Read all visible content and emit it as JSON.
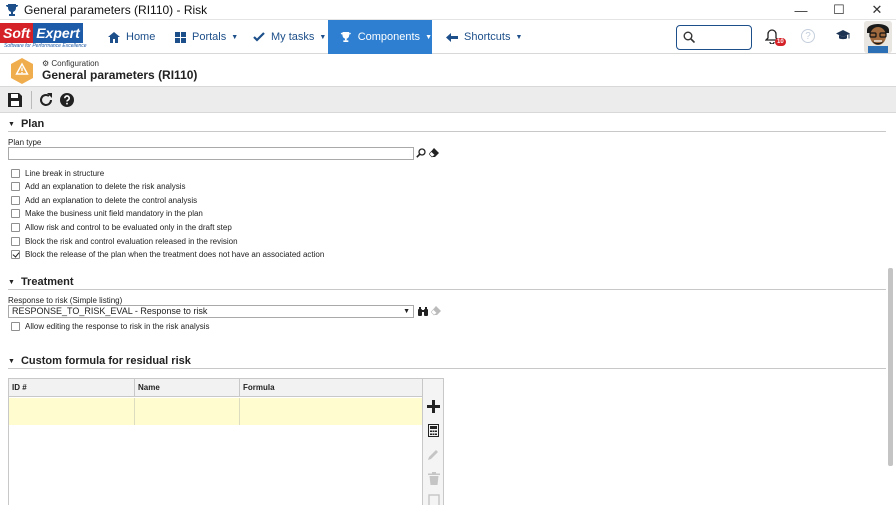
{
  "window": {
    "title": "General parameters (RI110) - Risk",
    "minimize": "—",
    "maximize": "☐",
    "close": "✕"
  },
  "logo": {
    "soft": "Soft",
    "expert": "Expert",
    "tagline": "Software for Performance Excellence"
  },
  "nav": {
    "home": "Home",
    "portals": "Portals",
    "my_tasks": "My tasks",
    "components": "Components",
    "shortcuts": "Shortcuts",
    "notification_count": "10",
    "help": "?"
  },
  "header": {
    "breadcrumb": "Configuration",
    "title": "General parameters (RI110)"
  },
  "plan": {
    "heading": "Plan",
    "plan_type_label": "Plan type",
    "plan_type_value": "",
    "options": [
      {
        "label": "Line break in structure",
        "checked": false
      },
      {
        "label": "Add an explanation to delete the risk analysis",
        "checked": false
      },
      {
        "label": "Add an explanation to delete the control analysis",
        "checked": false
      },
      {
        "label": "Make the business unit field mandatory in the plan",
        "checked": false
      },
      {
        "label": "Allow risk and control to be evaluated only in the draft step",
        "checked": false
      },
      {
        "label": "Block the risk and control evaluation released in the revision",
        "checked": false
      },
      {
        "label": "Block the release of the plan when the treatment does not have an associated action",
        "checked": true
      }
    ]
  },
  "treatment": {
    "heading": "Treatment",
    "response_label": "Response to risk (Simple listing)",
    "response_value": "RESPONSE_TO_RISK_EVAL - Response to risk",
    "allow_edit_label": "Allow editing the response to risk in the risk analysis",
    "allow_edit_checked": false
  },
  "formula": {
    "heading": "Custom formula for residual risk",
    "columns": [
      "ID #",
      "Name",
      "Formula"
    ],
    "rows": [
      [
        "",
        "",
        ""
      ]
    ]
  },
  "colors": {
    "nav_active": "#2e7fd1",
    "nav_text": "#1d4f8a",
    "warning": "#f0ad4e",
    "row_highlight": "#fffcd0"
  }
}
